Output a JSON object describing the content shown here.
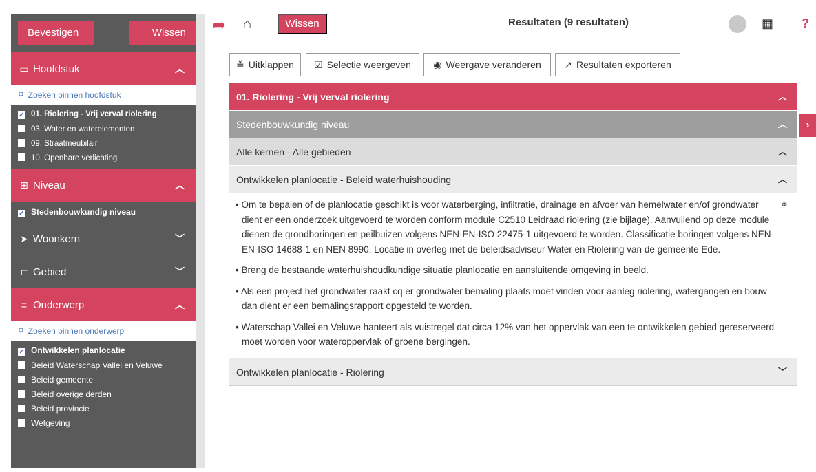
{
  "sidebar": {
    "confirm_label": "Bevestigen",
    "clear_label": "Wissen",
    "chapter": {
      "title": "Hoofdstuk",
      "search_placeholder": "Zoeken binnen hoofdstuk",
      "items": [
        {
          "label": "01. Riolering - Vrij verval riolering",
          "checked": true
        },
        {
          "label": "03. Water en waterelementen",
          "checked": false
        },
        {
          "label": "09. Straatmeubilair",
          "checked": false
        },
        {
          "label": "10. Openbare verlichting",
          "checked": false
        }
      ]
    },
    "level": {
      "title": "Niveau",
      "items": [
        {
          "label": "Stedenbouwkundig niveau",
          "checked": true
        }
      ]
    },
    "core": {
      "title": "Woonkern"
    },
    "area": {
      "title": "Gebied"
    },
    "subject": {
      "title": "Onderwerp",
      "search_placeholder": "Zoeken binnen onderwerp",
      "items": [
        {
          "label": "Ontwikkelen planlocatie",
          "checked": true
        },
        {
          "label": "Beleid Waterschap Vallei en Veluwe",
          "checked": false
        },
        {
          "label": "Beleid gemeente",
          "checked": false
        },
        {
          "label": "Beleid overige derden",
          "checked": false
        },
        {
          "label": "Beleid provincie",
          "checked": false
        },
        {
          "label": "Wetgeving",
          "checked": false
        }
      ]
    }
  },
  "topbar": {
    "clear_label": "Wissen",
    "title": "Resultaten (9 resultaten)"
  },
  "actions": {
    "expand": "Uitklappen",
    "show_selection": "Selectie weergeven",
    "change_view": "Weergave veranderen",
    "export": "Resultaten exporteren"
  },
  "results": {
    "chapter": "01. Riolering - Vrij verval riolering",
    "level": "Stedenbouwkundig niveau",
    "scope": "Alle kernen - Alle gebieden",
    "topic_open": "Ontwikkelen planlocatie - Beleid waterhuishouding",
    "bullets": [
      "• Om te bepalen of de planlocatie geschikt is voor waterberging, infiltratie, drainage en afvoer van hemelwater en/of grondwater dient er een onderzoek uitgevoerd te worden conform module C2510 Leidraad riolering (zie bijlage). Aanvullend op deze module dienen de grondboringen en peilbuizen volgens NEN-EN-ISO 22475-1 uitgevoerd te worden. Classificatie boringen volgens NEN-EN-ISO 14688-1 en NEN 8990. Locatie in overleg met de beleidsadviseur Water en Riolering van de gemeente Ede.",
      "• Breng de bestaande waterhuishoudkundige situatie planlocatie en aansluitende omgeving in beeld.",
      "• Als een project het grondwater raakt cq er grondwater bemaling plaats moet vinden voor aanleg riolering, watergangen en bouw dan dient er een bemalingsrapport opgesteld te worden.",
      "• Waterschap Vallei en Veluwe hanteert als vuistregel dat circa 12% van het oppervlak van een te ontwikkelen gebied gereserveerd moet worden voor wateroppervlak of groene bergingen."
    ],
    "topic_closed": "Ontwikkelen planlocatie - Riolering"
  },
  "colors": {
    "accent": "#d5445f",
    "sidebar_bg": "#5a5a5a",
    "level_row": "#9e9e9e",
    "scope_row": "#dcdcdc",
    "topic_row": "#ebebeb"
  }
}
